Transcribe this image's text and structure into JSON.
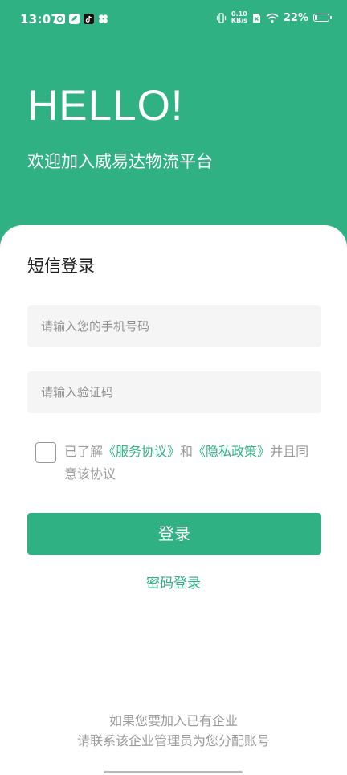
{
  "status_bar": {
    "time": "13:07",
    "net_speed_top": "0.10",
    "net_speed_bottom": "KB/s",
    "battery": "22%",
    "battery_level": 0.22,
    "icons": [
      "app-icon-1",
      "app-icon-2",
      "tiktok-icon",
      "clover-icon",
      "vibrate-icon",
      "sim-icon",
      "wifi-icon",
      "battery-icon"
    ]
  },
  "header": {
    "hello": "HELLO!",
    "welcome": "欢迎加入威易达物流平台"
  },
  "login": {
    "title": "短信登录",
    "phone_placeholder": "请输入您的手机号码",
    "code_placeholder": "请输入验证码",
    "agree_prefix": "已了解",
    "service_link": "《服务协议》",
    "and": "和",
    "privacy_link": "《隐私政策》",
    "agree_suffix": "并且同意该协议",
    "button": "登录",
    "password_login": "密码登录"
  },
  "footer": {
    "line1": "如果您要加入已有企业",
    "line2": "请联系该企业管理员为您分配账号"
  },
  "colors": {
    "primary": "#2fb183",
    "text_gray": "#9a9a9a"
  }
}
